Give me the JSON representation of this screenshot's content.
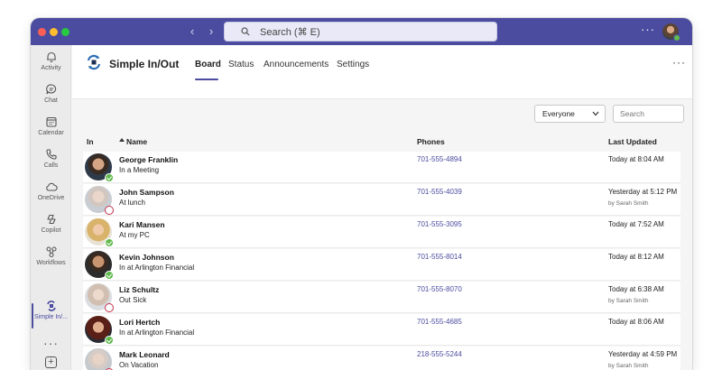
{
  "titlebar": {
    "search_placeholder": "Search (⌘ E)"
  },
  "rail": {
    "items": [
      {
        "label": "Activity",
        "icon": "bell-icon"
      },
      {
        "label": "Chat",
        "icon": "chat-icon"
      },
      {
        "label": "Calendar",
        "icon": "calendar-icon"
      },
      {
        "label": "Calls",
        "icon": "phone-icon"
      },
      {
        "label": "OneDrive",
        "icon": "cloud-icon"
      },
      {
        "label": "Copilot",
        "icon": "copilot-icon"
      },
      {
        "label": "Workflows",
        "icon": "workflow-icon"
      },
      {
        "label": "Simple In/...",
        "icon": "simple-inout-icon",
        "active": true
      }
    ]
  },
  "app": {
    "title": "Simple In/Out",
    "tabs": [
      {
        "label": "Board",
        "active": true
      },
      {
        "label": "Status"
      },
      {
        "label": "Announcements"
      },
      {
        "label": "Settings"
      }
    ]
  },
  "toolbar": {
    "filter_value": "Everyone",
    "search_placeholder": "Search"
  },
  "grid": {
    "headers": {
      "in": "In",
      "name": "Name",
      "phones": "Phones",
      "updated": "Last Updated"
    },
    "rows": [
      {
        "name": "George Franklin",
        "status": "In a Meeting",
        "phone": "701-555-4894",
        "updated": "Today at 8:04 AM",
        "by": "",
        "in": true
      },
      {
        "name": "John Sampson",
        "status": "At lunch",
        "phone": "701-555-4039",
        "updated": "Yesterday at 5:12 PM",
        "by": "by Sarah Smith",
        "in": false
      },
      {
        "name": "Kari Mansen",
        "status": "At my PC",
        "phone": "701-555-3095",
        "updated": "Today at 7:52 AM",
        "by": "",
        "in": true
      },
      {
        "name": "Kevin Johnson",
        "status": "In at Arlington Financial",
        "phone": "701-555-8014",
        "updated": "Today at 8:12 AM",
        "by": "",
        "in": true
      },
      {
        "name": "Liz Schultz",
        "status": "Out Sick",
        "phone": "701-555-8070",
        "updated": "Today at 6:38 AM",
        "by": "by Sarah Smith",
        "in": false
      },
      {
        "name": "Lori Hertch",
        "status": "In at Arlington Financial",
        "phone": "701-555-4685",
        "updated": "Today at 8:06 AM",
        "by": "",
        "in": true
      },
      {
        "name": "Mark Leonard",
        "status": "On Vacation",
        "phone": "218-555-5244",
        "updated": "Yesterday at 4:59 PM",
        "by": "by Sarah Smith",
        "in": false
      }
    ]
  },
  "colors": {
    "accent": "#4b4ca0",
    "in": "#5fb94c",
    "out": "#c4314b"
  }
}
